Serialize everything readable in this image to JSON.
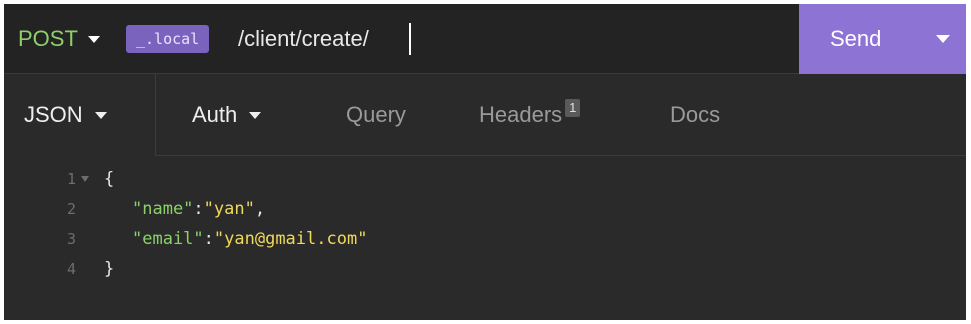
{
  "request": {
    "method": "POST",
    "env_tag": "_.local",
    "url_path": "/client/create/",
    "send_label": "Send"
  },
  "tabs": {
    "body_type": "JSON",
    "items": [
      {
        "label": "Auth",
        "dropdown": true,
        "active": true
      },
      {
        "label": "Query",
        "dropdown": false,
        "active": false
      },
      {
        "label": "Headers",
        "dropdown": false,
        "active": false,
        "badge": "1"
      },
      {
        "label": "Docs",
        "dropdown": false,
        "active": false
      }
    ]
  },
  "editor": {
    "line_numbers": [
      "1",
      "2",
      "3",
      "4"
    ],
    "lines": [
      {
        "open": "{"
      },
      {
        "key": "\"name\"",
        "sep": ":",
        "value": "\"yan\"",
        "end": ","
      },
      {
        "key": "\"email\"",
        "sep": ":",
        "value": "\"yan@gmail.com\"",
        "end": ""
      },
      {
        "close": "}"
      }
    ]
  },
  "colors": {
    "method_green": "#8dd06b",
    "send_purple": "#8c73d4",
    "env_tag_purple": "#7a63bd",
    "json_key": "#8bd16a",
    "json_string": "#f0d85a"
  }
}
